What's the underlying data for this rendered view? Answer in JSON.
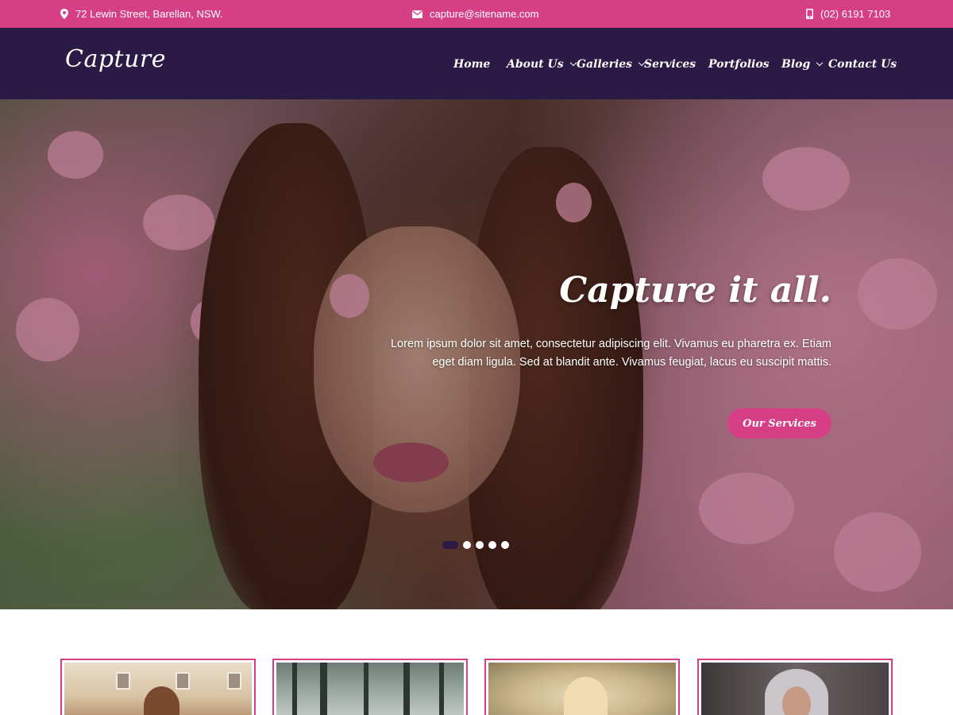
{
  "topbar": {
    "address": "72 Lewin Street, Barellan, NSW.",
    "email": "capture@sitename.com",
    "phone": "(02) 6191 7103",
    "icons": [
      "map-pin-icon",
      "envelope-icon",
      "mobile-phone-icon"
    ],
    "background_color": "#d63f86"
  },
  "header": {
    "logo": "Capture",
    "background_color": "#2a1a45",
    "nav": [
      {
        "label": "Home",
        "has_dropdown": false
      },
      {
        "label": "About Us",
        "has_dropdown": true
      },
      {
        "label": "Galleries",
        "has_dropdown": true
      },
      {
        "label": "Services",
        "has_dropdown": false
      },
      {
        "label": "Portfolios",
        "has_dropdown": false
      },
      {
        "label": "Blog",
        "has_dropdown": true
      },
      {
        "label": "Contact Us",
        "has_dropdown": false
      }
    ]
  },
  "hero": {
    "title": "Capture it all.",
    "text": "Lorem ipsum dolor sit amet, consectetur adipiscing elit. Vivamus eu pharetra ex. Etiam eget diam ligula. Sed at blandit ante. Vivamus feugiat, lacus eu suscipit mattis.",
    "button_label": "Our Services",
    "slide_count": 5,
    "active_slide": 1,
    "accent_color": "#d63f86"
  },
  "gallery_cards": {
    "count": 4,
    "border_color": "#d63f86"
  }
}
